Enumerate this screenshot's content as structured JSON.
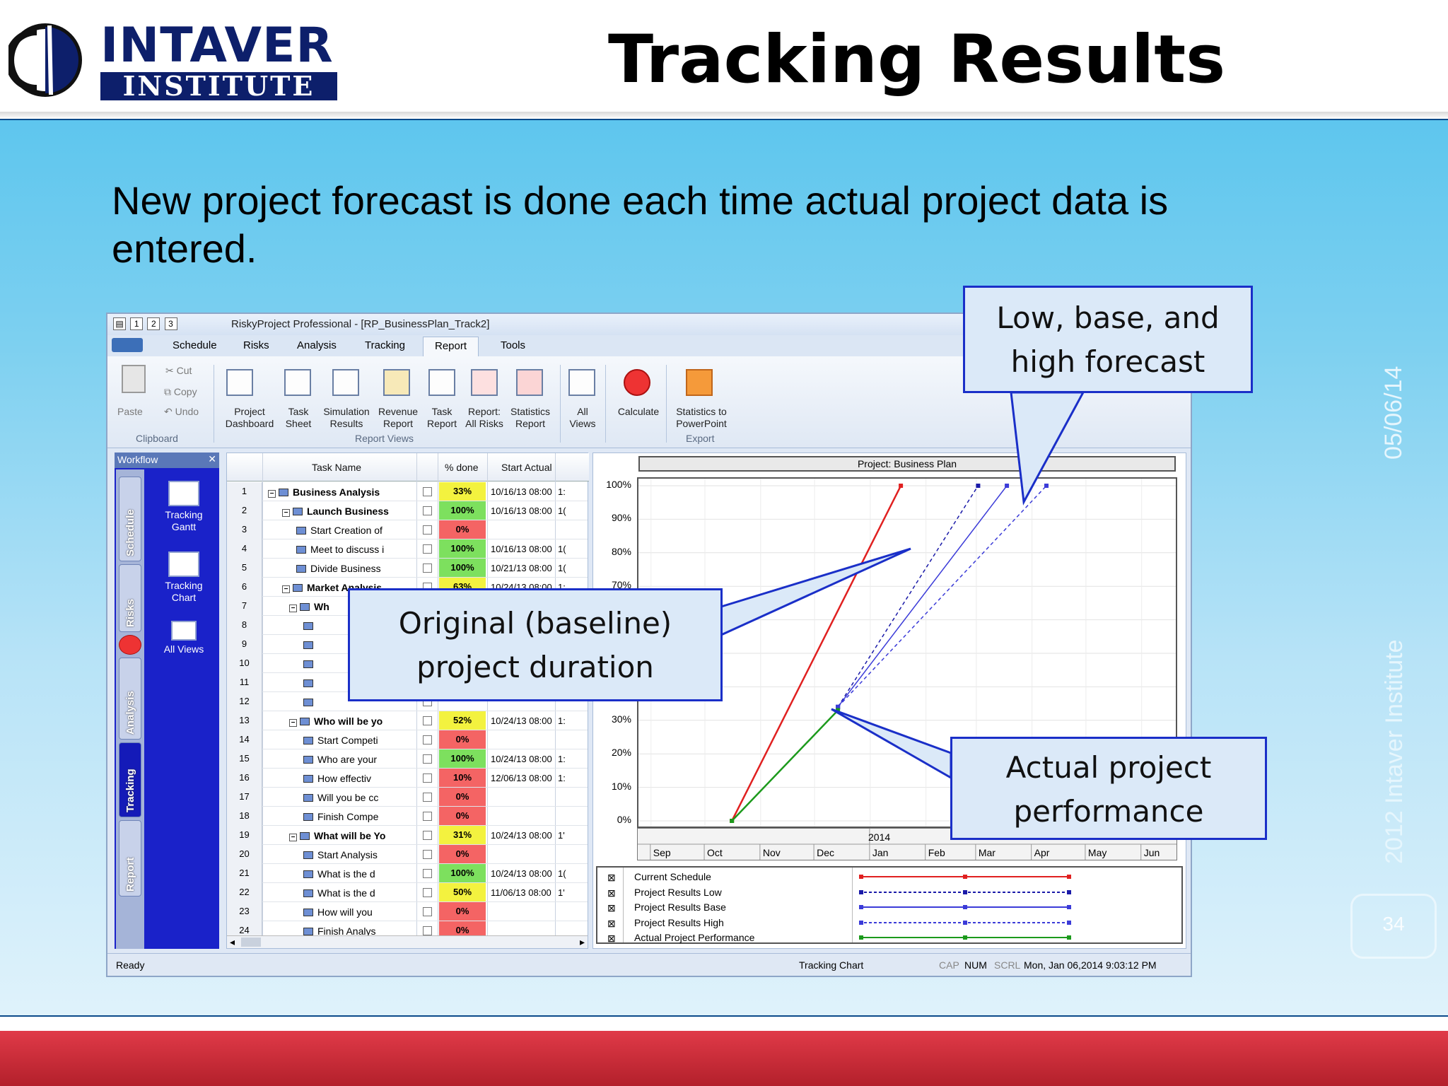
{
  "slide": {
    "title": "Tracking Results",
    "logo_top": "INTAVER",
    "logo_bottom": "INSTITUTE",
    "intro": "New project forecast is done each time actual project data is entered.",
    "date": "05/06/14",
    "copyright": "2012 Intaver Institute",
    "page_number": "34"
  },
  "app": {
    "window_title": "RiskyProject Professional - [RP_BusinessPlan_Track2]",
    "qa_buttons": [
      "1",
      "2",
      "3"
    ],
    "tabs": [
      "Schedule",
      "Risks",
      "Analysis",
      "Tracking",
      "Report",
      "Tools"
    ],
    "active_tab": "Report",
    "ribbon": {
      "paste": "Paste",
      "cut": "Cut",
      "copy": "Copy",
      "undo": "Undo",
      "clipboard_label": "Clipboard",
      "buttons": [
        {
          "l1": "Project",
          "l2": "Dashboard"
        },
        {
          "l1": "Task",
          "l2": "Sheet"
        },
        {
          "l1": "Simulation",
          "l2": "Results"
        },
        {
          "l1": "Revenue",
          "l2": "Report"
        },
        {
          "l1": "Task",
          "l2": "Report"
        },
        {
          "l1": "Report:",
          "l2": "All Risks"
        },
        {
          "l1": "Statistics",
          "l2": "Report"
        }
      ],
      "report_views_label": "Report Views",
      "all_views": {
        "l1": "All",
        "l2": "Views"
      },
      "calculate": "Calculate",
      "stats_ppt": {
        "l1": "Statistics to",
        "l2": "PowerPoint"
      },
      "export_label": "Export"
    },
    "workflow": {
      "header": "Workflow",
      "vtabs": [
        "Schedule",
        "Risks",
        "Analysis",
        "Tracking",
        "Report"
      ],
      "items": [
        {
          "l1": "Tracking",
          "l2": "Gantt"
        },
        {
          "l1": "Tracking",
          "l2": "Chart"
        },
        {
          "l1": "All Views",
          "l2": ""
        }
      ]
    },
    "grid": {
      "headers": {
        "task": "Task Name",
        "pct": "% done",
        "start": "Start Actual"
      },
      "rows": [
        {
          "n": "1",
          "name": "Business Analysis",
          "pct": "33%",
          "c": "y",
          "start": "10/16/13 08:00",
          "x": "1:",
          "lvl": 0,
          "bold": true,
          "exp": "−"
        },
        {
          "n": "2",
          "name": "Launch Business",
          "pct": "100%",
          "c": "g",
          "start": "10/16/13 08:00",
          "x": "1(",
          "lvl": 1,
          "bold": true,
          "exp": "−"
        },
        {
          "n": "3",
          "name": "Start Creation of",
          "pct": "0%",
          "c": "r",
          "start": "",
          "x": "",
          "lvl": 2,
          "bold": false,
          "exp": ""
        },
        {
          "n": "4",
          "name": "Meet to discuss i",
          "pct": "100%",
          "c": "g",
          "start": "10/16/13 08:00",
          "x": "1(",
          "lvl": 2,
          "bold": false,
          "exp": ""
        },
        {
          "n": "5",
          "name": "Divide Business",
          "pct": "100%",
          "c": "g",
          "start": "10/21/13 08:00",
          "x": "1(",
          "lvl": 2,
          "bold": false,
          "exp": ""
        },
        {
          "n": "6",
          "name": "Market Analysis",
          "pct": "63%",
          "c": "y",
          "start": "10/24/13 08:00",
          "x": "1:",
          "lvl": 1,
          "bold": true,
          "exp": "−"
        },
        {
          "n": "7",
          "name": "Wh",
          "pct": "",
          "c": "",
          "start": "",
          "x": "",
          "lvl": 1.5,
          "bold": true,
          "exp": "−"
        },
        {
          "n": "8",
          "name": "",
          "pct": "",
          "c": "",
          "start": "",
          "x": "",
          "lvl": 2.5,
          "bold": false,
          "exp": ""
        },
        {
          "n": "9",
          "name": "",
          "pct": "",
          "c": "",
          "start": "",
          "x": "",
          "lvl": 2.5,
          "bold": false,
          "exp": ""
        },
        {
          "n": "10",
          "name": "",
          "pct": "",
          "c": "",
          "start": "",
          "x": "",
          "lvl": 2.5,
          "bold": false,
          "exp": ""
        },
        {
          "n": "11",
          "name": "",
          "pct": "",
          "c": "",
          "start": "",
          "x": "",
          "lvl": 2.5,
          "bold": false,
          "exp": ""
        },
        {
          "n": "12",
          "name": "",
          "pct": "",
          "c": "",
          "start": "",
          "x": "",
          "lvl": 2.5,
          "bold": false,
          "exp": ""
        },
        {
          "n": "13",
          "name": "Who will be yo",
          "pct": "52%",
          "c": "y",
          "start": "10/24/13 08:00",
          "x": "1:",
          "lvl": 1.5,
          "bold": true,
          "exp": "−"
        },
        {
          "n": "14",
          "name": "Start Competi",
          "pct": "0%",
          "c": "r",
          "start": "",
          "x": "",
          "lvl": 2.5,
          "bold": false,
          "exp": ""
        },
        {
          "n": "15",
          "name": "Who are your",
          "pct": "100%",
          "c": "g",
          "start": "10/24/13 08:00",
          "x": "1:",
          "lvl": 2.5,
          "bold": false,
          "exp": ""
        },
        {
          "n": "16",
          "name": "How effectiv",
          "pct": "10%",
          "c": "r",
          "start": "12/06/13 08:00",
          "x": "1:",
          "lvl": 2.5,
          "bold": false,
          "exp": ""
        },
        {
          "n": "17",
          "name": "Will you be cc",
          "pct": "0%",
          "c": "r",
          "start": "",
          "x": "",
          "lvl": 2.5,
          "bold": false,
          "exp": ""
        },
        {
          "n": "18",
          "name": "Finish Compe",
          "pct": "0%",
          "c": "r",
          "start": "",
          "x": "",
          "lvl": 2.5,
          "bold": false,
          "exp": ""
        },
        {
          "n": "19",
          "name": "What will be Yo",
          "pct": "31%",
          "c": "y",
          "start": "10/24/13 08:00",
          "x": "1'",
          "lvl": 1.5,
          "bold": true,
          "exp": "−"
        },
        {
          "n": "20",
          "name": "Start Analysis",
          "pct": "0%",
          "c": "r",
          "start": "",
          "x": "",
          "lvl": 2.5,
          "bold": false,
          "exp": ""
        },
        {
          "n": "21",
          "name": "What is the d",
          "pct": "100%",
          "c": "g",
          "start": "10/24/13 08:00",
          "x": "1(",
          "lvl": 2.5,
          "bold": false,
          "exp": ""
        },
        {
          "n": "22",
          "name": "What is the d",
          "pct": "50%",
          "c": "y",
          "start": "11/06/13 08:00",
          "x": "1'",
          "lvl": 2.5,
          "bold": false,
          "exp": ""
        },
        {
          "n": "23",
          "name": "How will you",
          "pct": "0%",
          "c": "r",
          "start": "",
          "x": "",
          "lvl": 2.5,
          "bold": false,
          "exp": ""
        },
        {
          "n": "24",
          "name": "Finish Analys",
          "pct": "0%",
          "c": "r",
          "start": "",
          "x": "",
          "lvl": 2.5,
          "bold": false,
          "exp": ""
        }
      ]
    },
    "status": {
      "ready": "Ready",
      "view": "Tracking Chart",
      "cap": "CAP",
      "num": "NUM",
      "scrl": "SCRL",
      "datetime": "Mon, Jan 06,2014  9:03:12 PM"
    }
  },
  "chart_data": {
    "type": "line",
    "title": "Project: Business Plan",
    "yticks": [
      "100%",
      "90%",
      "80%",
      "70%",
      "30%",
      "20%",
      "10%",
      "0%"
    ],
    "ylim": [
      0,
      100
    ],
    "year_label": "2014",
    "months": [
      "Sep",
      "Oct",
      "Nov",
      "Dec",
      "Jan",
      "Feb",
      "Mar",
      "Apr",
      "May",
      "Jun"
    ],
    "series": [
      {
        "name": "Current Schedule",
        "color": "#e02020",
        "dash": false,
        "points": [
          [
            "Oct 16 2013",
            0
          ],
          [
            "Jan 18 2014",
            100
          ]
        ]
      },
      {
        "name": "Project Results Low",
        "color": "#1a1aa8",
        "dash": true,
        "points": [
          [
            "Dec 14 2013",
            34
          ],
          [
            "Mar 2 2014",
            100
          ]
        ]
      },
      {
        "name": "Project Results Base",
        "color": "#3b3bd8",
        "dash": false,
        "points": [
          [
            "Dec 14 2013",
            34
          ],
          [
            "Mar 18 2014",
            100
          ]
        ]
      },
      {
        "name": "Project Results High",
        "color": "#3b3bd8",
        "dash": true,
        "points": [
          [
            "Dec 14 2013",
            34
          ],
          [
            "Apr 9 2014",
            100
          ]
        ]
      },
      {
        "name": "Actual Project Performance",
        "color": "#1c9a1c",
        "dash": false,
        "points": [
          [
            "Oct 16 2013",
            0
          ],
          [
            "Dec 14 2013",
            33
          ]
        ]
      }
    ]
  },
  "callouts": {
    "forecast": "Low, base, and high forecast",
    "baseline": "Original (baseline) project duration",
    "actual": "Actual project performance"
  }
}
